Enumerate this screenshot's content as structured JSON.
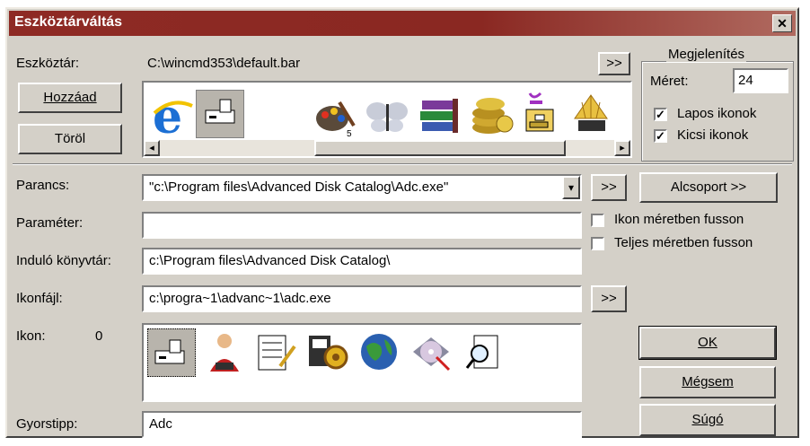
{
  "window": {
    "title": "Eszköztárváltás",
    "close_glyph": "✕"
  },
  "toolbar": {
    "label": "Eszköztár:",
    "path": "C:\\wincmd353\\default.bar",
    "browse_label": ">>",
    "add_label": "Hozzáad",
    "delete_label": "Töröl",
    "icons": [
      "internet-explorer-icon",
      "drive-icon",
      "palette-icon",
      "butterfly-icon",
      "winrar-books-icon",
      "coins-icon",
      "cabinet-icon",
      "shell-icon"
    ]
  },
  "display": {
    "group_label": "Megjelenítés",
    "size_label": "Méret:",
    "size_value": "24",
    "flat_icons_label": "Lapos ikonok",
    "flat_icons_checked": true,
    "small_icons_label": "Kicsi ikonok",
    "small_icons_checked": true
  },
  "command": {
    "label": "Parancs:",
    "value": "\"c:\\Program files\\Advanced Disk Catalog\\Adc.exe\"",
    "browse_label": ">>",
    "subgroup_label": "Alcsoport >>"
  },
  "parameter": {
    "label": "Paraméter:",
    "value": ""
  },
  "run_options": {
    "icon_size_label": "Ikon méretben fusson",
    "icon_size_checked": false,
    "full_size_label": "Teljes méretben fusson",
    "full_size_checked": false
  },
  "start_dir": {
    "label": "Induló könyvtár:",
    "value": "c:\\Program files\\Advanced Disk Catalog\\"
  },
  "icon_file": {
    "label": "Ikonfájl:",
    "value": "c:\\progra~1\\advanc~1\\adc.exe",
    "browse_label": ">>"
  },
  "icon": {
    "label": "Ikon:",
    "index": "0",
    "icons": [
      "drive-icon",
      "person-icon",
      "notepad-icon",
      "gear-window-icon",
      "globe-icon",
      "disc-icon",
      "magnifier-document-icon"
    ]
  },
  "tooltip": {
    "label": "Gyorstipp:",
    "value": "Adc"
  },
  "buttons": {
    "ok": "OK",
    "cancel": "Mégsem",
    "help": "Súgó"
  },
  "check_glyph": "✓",
  "scroll_left_glyph": "◂",
  "scroll_right_glyph": "▸",
  "dropdown_glyph": "▾"
}
